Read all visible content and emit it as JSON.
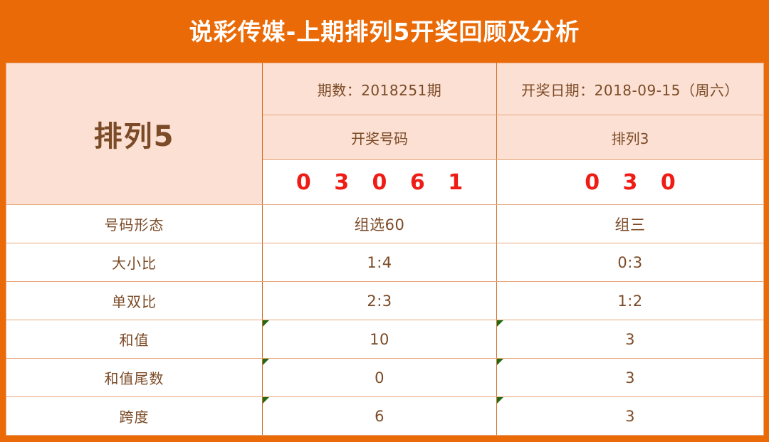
{
  "header": {
    "title": "说彩传媒-上期排列5开奖回顾及分析",
    "title_color": "#ffffff",
    "background_color": "#e96a06"
  },
  "palette": {
    "orange": "#e96a06",
    "peach": "#fbe0d3",
    "white": "#ffffff",
    "brown_text": "#7b4a26",
    "red_numbers": "#ef1c15",
    "grid_line_light": "#e8a87c",
    "grid_line_dark": "#d2691e",
    "corner_flag_green": "#1d6b16"
  },
  "table": {
    "brand_label": "排列5",
    "issue_label": "期数：2018251期",
    "draw_date_label": "开奖日期：2018-09-15（周六）",
    "col2_header": "开奖号码",
    "col3_header": "排列3",
    "col2_numbers": "0 3 0 6 1",
    "col3_numbers": "0 3 0",
    "rows": [
      {
        "label": "号码形态",
        "p5": "组选60",
        "p3": "组三",
        "flag": false
      },
      {
        "label": "大小比",
        "p5": "1:4",
        "p3": "0:3",
        "flag": false
      },
      {
        "label": "单双比",
        "p5": "2:3",
        "p3": "1:2",
        "flag": false
      },
      {
        "label": "和值",
        "p5": "10",
        "p3": "3",
        "flag": true
      },
      {
        "label": "和值尾数",
        "p5": "0",
        "p3": "3",
        "flag": true
      },
      {
        "label": "跨度",
        "p5": "6",
        "p3": "3",
        "flag": true
      }
    ]
  }
}
